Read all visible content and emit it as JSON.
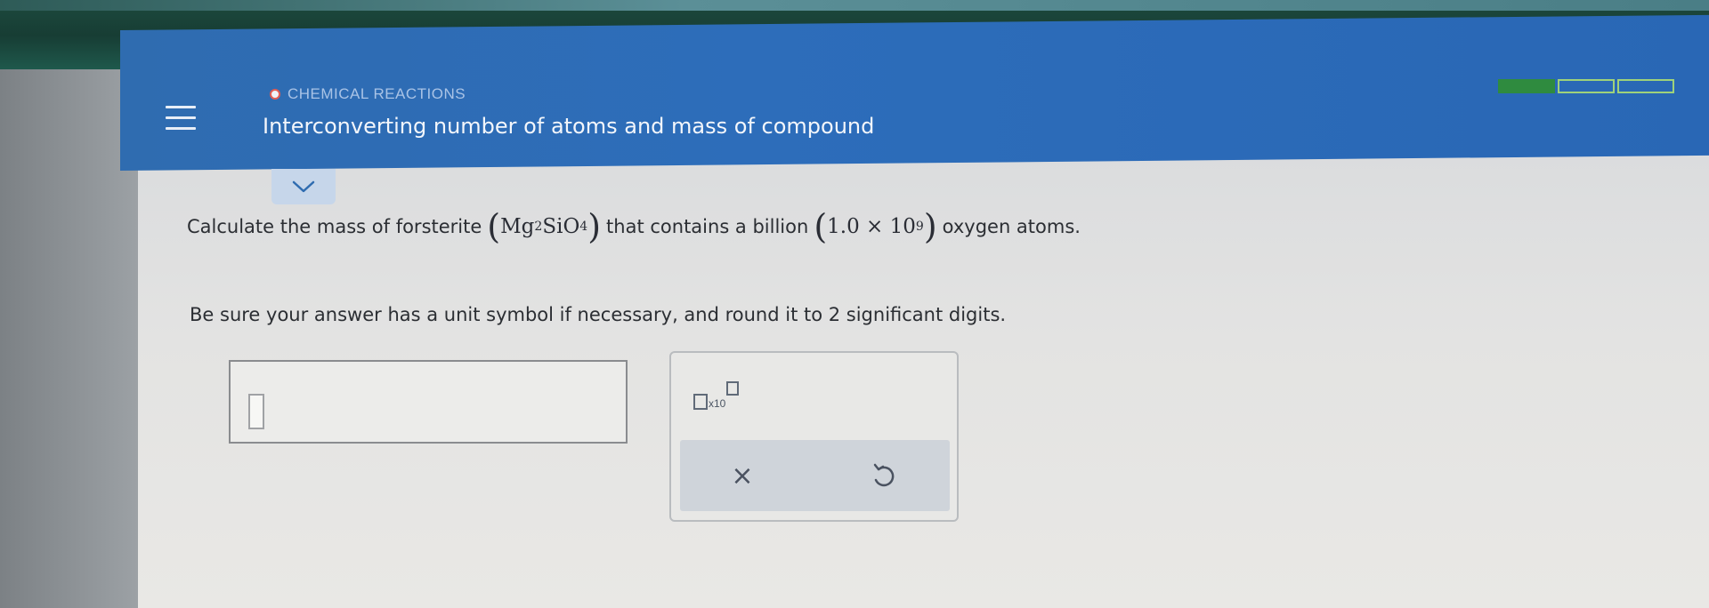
{
  "header": {
    "topic": "CHEMICAL REACTIONS",
    "title": "Interconverting number of atoms and mass of compound",
    "progress": {
      "filled_segments": 1,
      "total_segments": 3
    }
  },
  "question": {
    "prefix": "Calculate the mass of forsterite",
    "formula_mg": "Mg",
    "formula_mg_sub": "2",
    "formula_sio": "SiO",
    "formula_o_sub": "4",
    "middle": "that contains a billion",
    "number_mantissa": "1.0 × 10",
    "number_exponent": "9",
    "suffix": "oxygen atoms."
  },
  "instructions": "Be sure your answer has a unit symbol if necessary, and round it to 2 significant digits.",
  "answer": {
    "value": ""
  },
  "tools": {
    "sci_notation_label": "x10",
    "clear_symbol": "×"
  },
  "icons": {
    "menu": "hamburger-menu-icon",
    "collapse": "chevron-down-icon",
    "undo": "undo-icon"
  },
  "colors": {
    "header_blue": "#2d6dba",
    "progress_green": "#2f8b3f",
    "topic_dot": "#e35d52"
  }
}
